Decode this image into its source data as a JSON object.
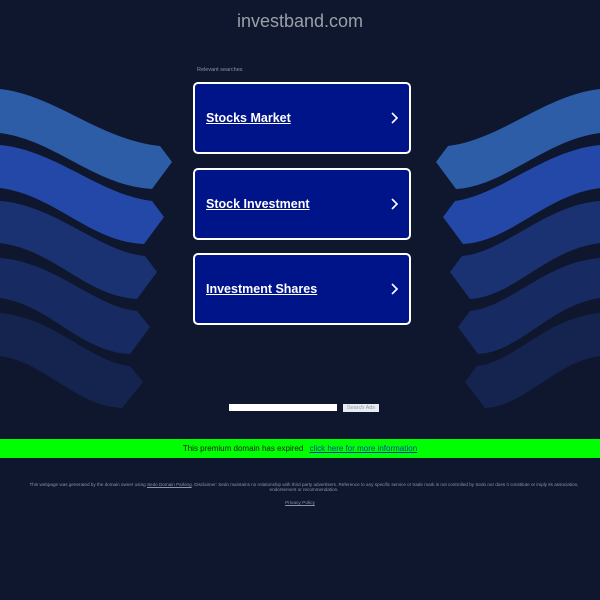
{
  "header": {
    "domain": "investband.com"
  },
  "relevant_searches": {
    "label": "Relevant searches",
    "items": [
      {
        "label": "Stocks Market",
        "icon": "chevron-right-icon"
      },
      {
        "label": "Stock Investment",
        "icon": "chevron-right-icon"
      },
      {
        "label": "Investment Shares",
        "icon": "chevron-right-icon"
      }
    ]
  },
  "search": {
    "value": "",
    "placeholder": "",
    "button_label": "Search Ads"
  },
  "banner": {
    "text": "This premium domain has expired",
    "link_text": "click here for more information",
    "color": "#00ff00"
  },
  "footer": {
    "disclaimer_prefix": "This webpage was generated by the domain owner using",
    "disclaimer_link": "Sedo Domain Parking",
    "disclaimer_suffix": ". Disclaimer: Sedo maintains no relationship with third party advertisers. Reference to any specific service or trade mark is not controlled by Sedo nor does it constitute or imply its association, endorsement or recommendation.",
    "privacy_link": "Privacy Policy"
  },
  "colors": {
    "background": "#0e172e",
    "result_box": "#001489",
    "wave_1": "#2e5da8",
    "wave_2": "#2448a8",
    "wave_3": "#1a3272",
    "wave_4": "#172a62",
    "wave_5": "#15244f"
  }
}
